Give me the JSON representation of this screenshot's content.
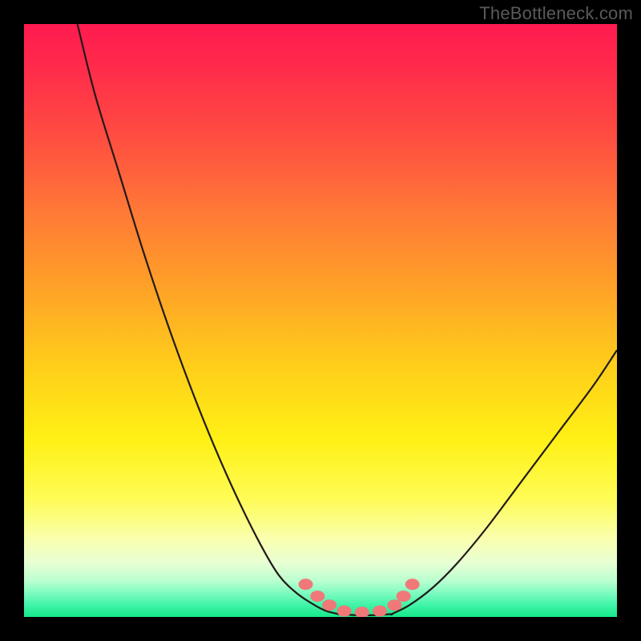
{
  "watermark": "TheBottleneck.com",
  "colors": {
    "frame_bg": "#000000",
    "curve_stroke": "#221a18",
    "dot_fill": "#f07878",
    "dot_stroke": "#c95b5b"
  },
  "chart_data": {
    "type": "line",
    "title": "",
    "xlabel": "",
    "ylabel": "",
    "xlim": [
      0,
      100
    ],
    "ylim": [
      0,
      100
    ],
    "series": [
      {
        "name": "left-branch",
        "x": [
          9,
          12,
          16,
          20,
          24,
          28,
          32,
          36,
          40,
          43,
          46,
          49,
          51,
          53
        ],
        "y": [
          100,
          88,
          75,
          62,
          50,
          39,
          29,
          20,
          12,
          7,
          4,
          2,
          1,
          0.5
        ]
      },
      {
        "name": "floor",
        "x": [
          53,
          56,
          59,
          62
        ],
        "y": [
          0.5,
          0.3,
          0.3,
          0.5
        ]
      },
      {
        "name": "right-branch",
        "x": [
          62,
          65,
          69,
          73,
          78,
          84,
          90,
          96,
          100
        ],
        "y": [
          0.5,
          2,
          5,
          9,
          15,
          23,
          31,
          39,
          45
        ]
      }
    ],
    "dots": {
      "name": "markers",
      "x": [
        47.5,
        49.5,
        51.5,
        54,
        57,
        60,
        62.5,
        64,
        65.5
      ],
      "y": [
        5.5,
        3.5,
        2,
        1,
        0.8,
        1,
        2,
        3.5,
        5.5
      ]
    }
  }
}
